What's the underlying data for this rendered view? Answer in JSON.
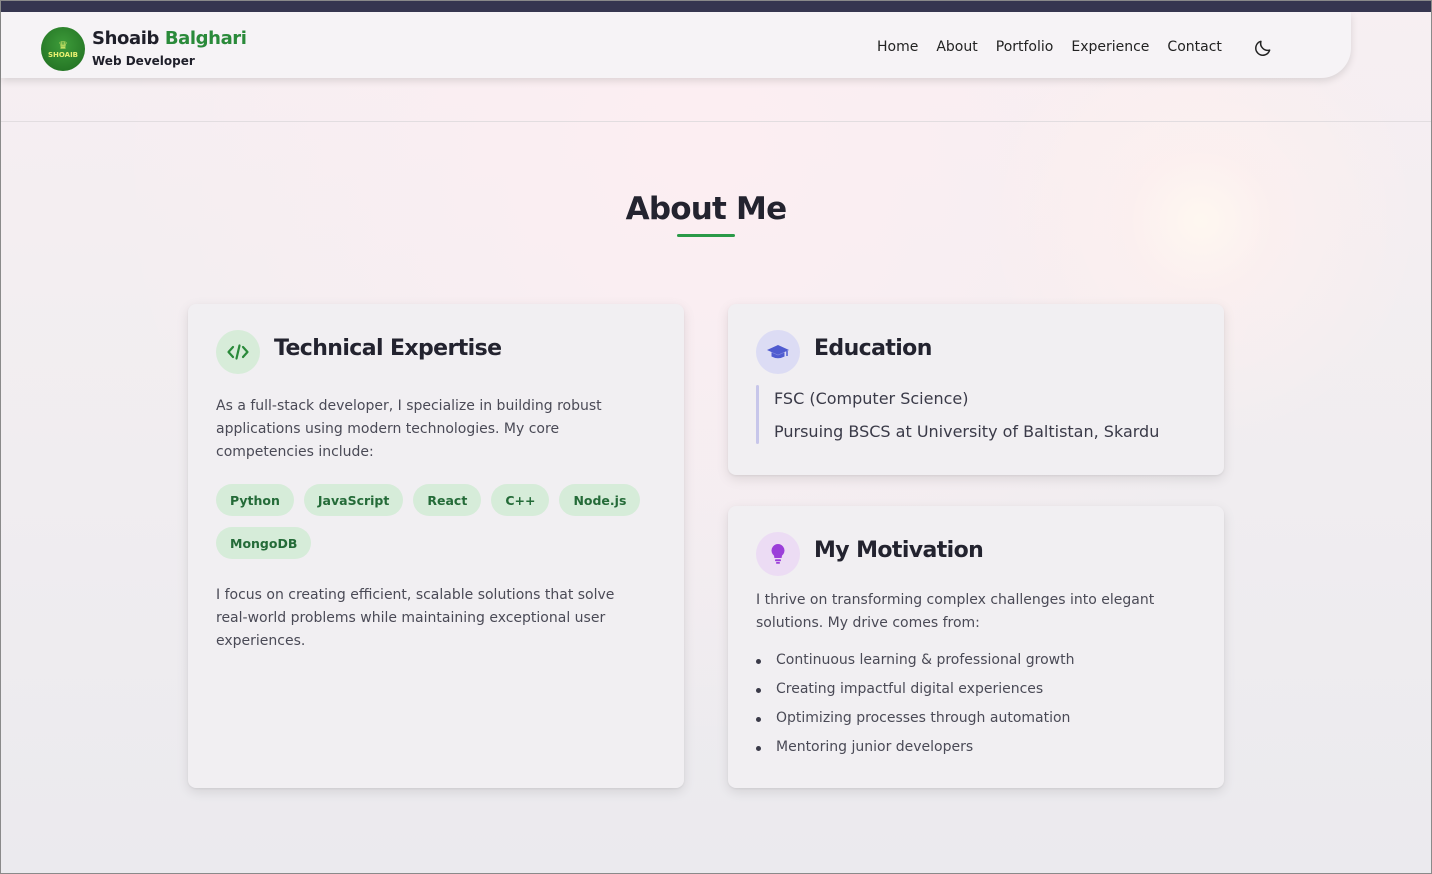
{
  "header": {
    "brand_first": "Shoaib",
    "brand_last": "Balghari",
    "role": "Web Developer",
    "logo_text": "SHOAIB",
    "nav": [
      "Home",
      "About",
      "Portfolio",
      "Experience",
      "Contact"
    ],
    "theme_icon": "moon-icon"
  },
  "about": {
    "title": "About Me",
    "technical": {
      "icon": "code-icon",
      "title": "Technical Expertise",
      "intro": "As a full-stack developer, I specialize in building robust applications using modern technologies. My core competencies include:",
      "skills": [
        "Python",
        "JavaScript",
        "React",
        "C++",
        "Node.js",
        "MongoDB"
      ],
      "outro": "I focus on creating efficient, scalable solutions that solve real-world problems while maintaining exceptional user experiences."
    },
    "education": {
      "icon": "graduation-cap-icon",
      "title": "Education",
      "items": [
        "FSC (Computer Science)",
        "Pursuing BSCS at University of Baltistan, Skardu"
      ]
    },
    "motivation": {
      "icon": "lightbulb-icon",
      "title": "My Motivation",
      "intro": "I thrive on transforming complex challenges into elegant solutions. My drive comes from:",
      "points": [
        "Continuous learning & professional growth",
        "Creating impactful digital experiences",
        "Optimizing processes through automation",
        "Mentoring junior developers"
      ]
    }
  },
  "colors": {
    "accent": "#2a9a48",
    "brand_green": "#2a8a3a",
    "tag_bg": "#d6ecd9",
    "edu_icon_bg": "#dcdcf4",
    "motivation_icon_bg": "#ecdcf4"
  }
}
